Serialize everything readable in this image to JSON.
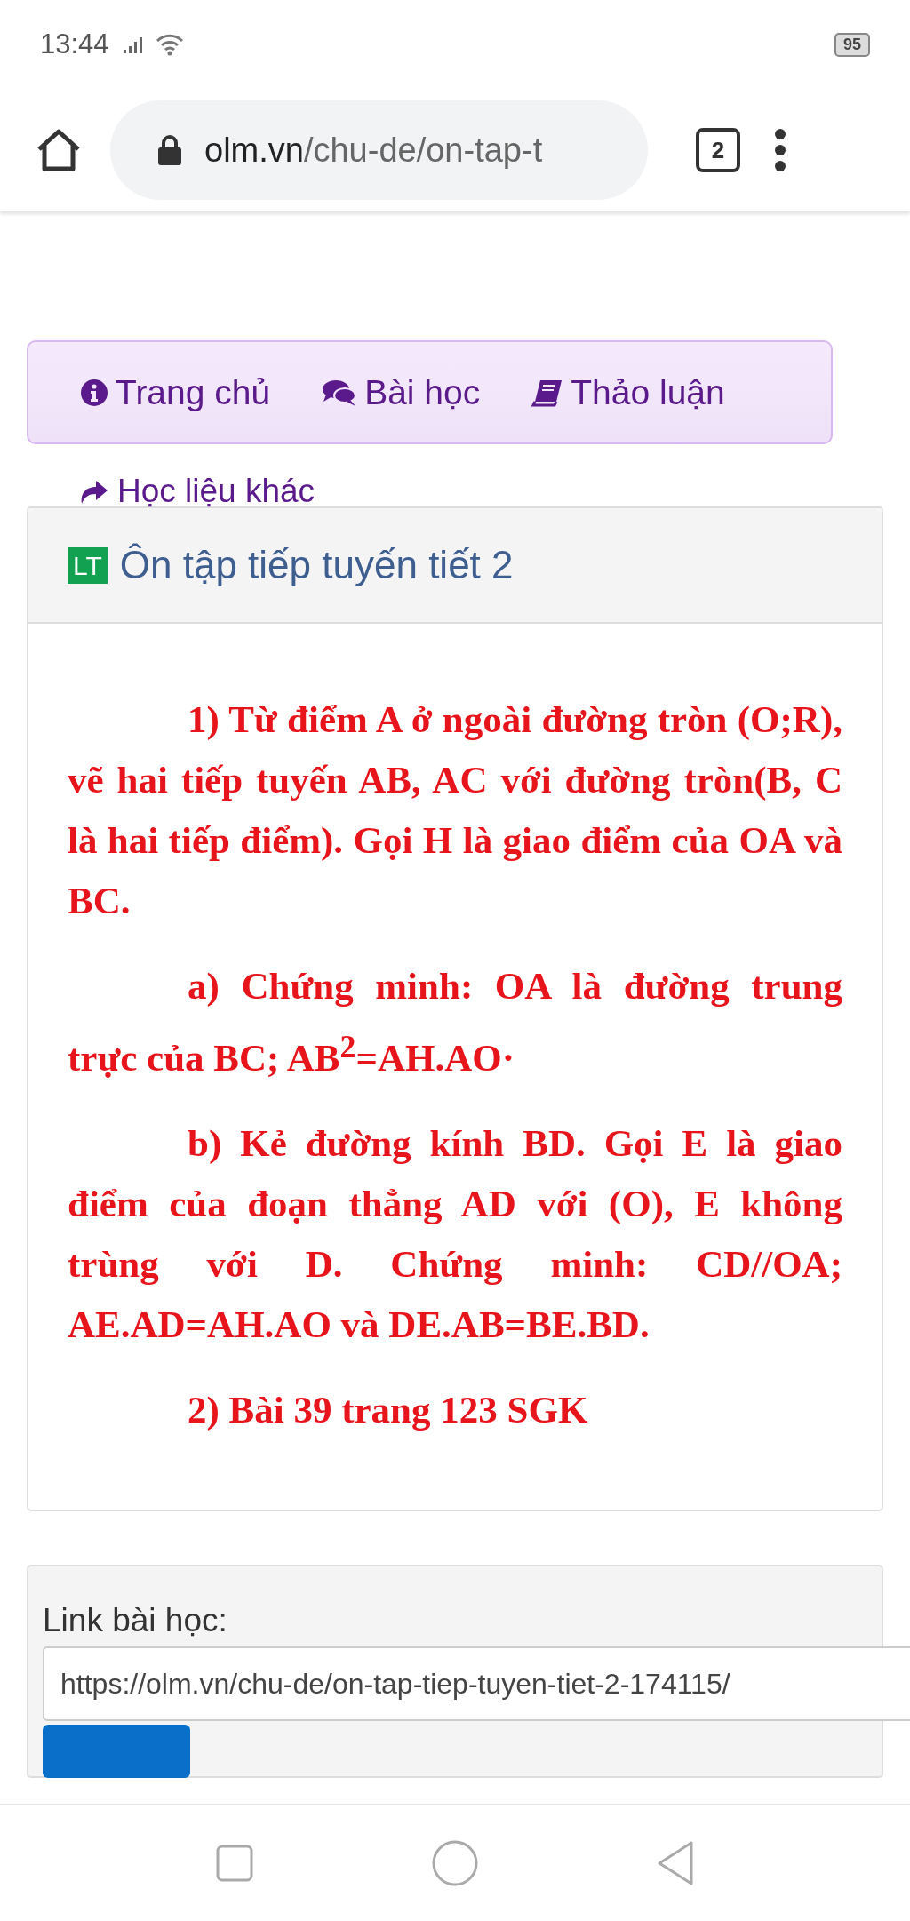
{
  "status_bar": {
    "time": "13:44",
    "battery": "95"
  },
  "browser": {
    "url_domain": "olm.vn",
    "url_path": "/chu-de/on-tap-t",
    "tab_count": "2"
  },
  "nav_menu": [
    {
      "label": "Trang chủ"
    },
    {
      "label": "Bài học"
    },
    {
      "label": "Thảo luận"
    }
  ],
  "more_link": "Học liệu khác",
  "lesson": {
    "badge": "LT",
    "title": "Ôn tập tiếp tuyến tiết 2",
    "paragraphs": [
      "1) Từ điểm A ở ngoài đường tròn (O;R), vẽ hai tiếp tuyến AB, AC với đường tròn(B, C là hai tiếp điểm). Gọi H là giao điểm của OA và BC.",
      "a) Chứng minh: OA là đường trung trực của BC; AB$^{2}$=AH.AO·",
      "b) Kẻ đường kính BD. Gọi E là giao điểm của đoạn thẳng AD với (O), E không trùng với D. Chứng minh: CD//OA; AE.AD=AH.AO và DE.AB=BE.BD.",
      "2) Bài 39 trang 123 SGK"
    ]
  },
  "share": {
    "label": "Link bài học:",
    "value": "https://olm.vn/chu-de/on-tap-tiep-tuyen-tiet-2-174115/"
  }
}
